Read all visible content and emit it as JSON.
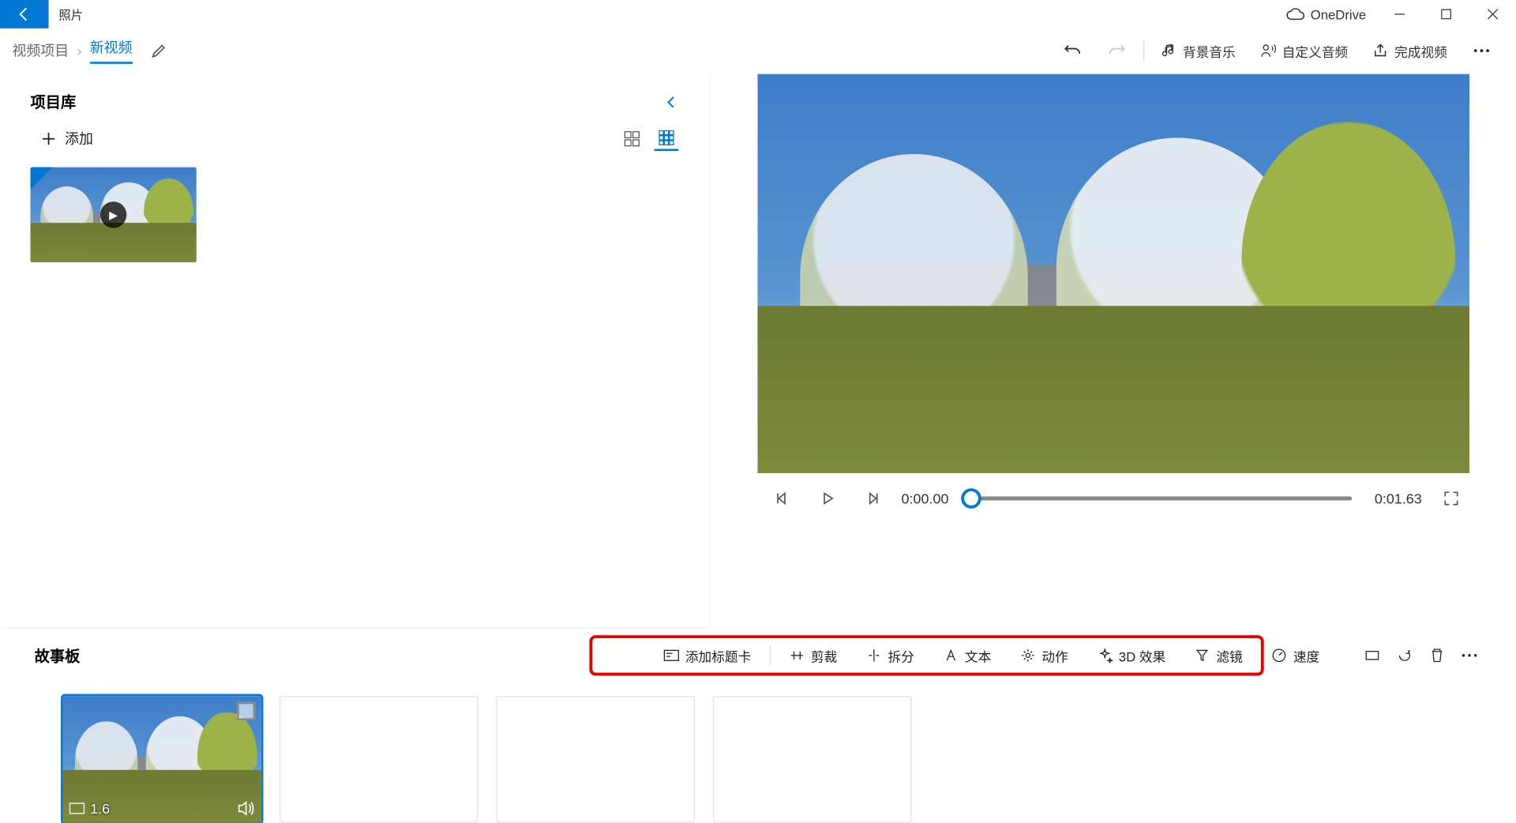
{
  "title_bar": {
    "app_name": "照片",
    "onedrive_label": "OneDrive"
  },
  "breadcrumb": {
    "root": "视频项目",
    "current": "新视频"
  },
  "top_actions": {
    "bg_music": "背景音乐",
    "custom_audio": "自定义音频",
    "finish_video": "完成视频"
  },
  "library": {
    "title": "项目库",
    "add_label": "添加"
  },
  "player": {
    "time_current": "0:00.00",
    "time_total": "0:01.63"
  },
  "storyboard": {
    "title": "故事板",
    "tools": {
      "title_card": "添加标题卡",
      "trim": "剪裁",
      "split": "拆分",
      "text": "文本",
      "motion": "动作",
      "fx3d": "3D 效果",
      "filter": "滤镜",
      "speed": "速度"
    },
    "clip_duration": "1.6"
  }
}
